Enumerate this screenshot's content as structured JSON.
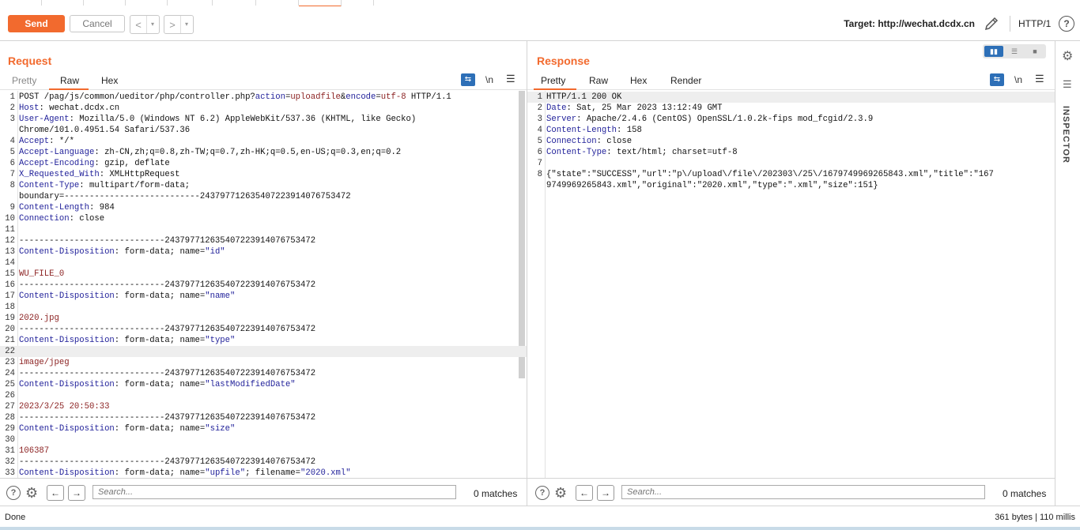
{
  "toolbar": {
    "send_label": "Send",
    "cancel_label": "Cancel",
    "back_glyph": "<",
    "forward_glyph": ">",
    "dropdown_glyph": "▾",
    "target_label": "Target: http://wechat.dcdx.cn",
    "protocol_label": "HTTP/1",
    "help_glyph": "?"
  },
  "request": {
    "title": "Request",
    "tabs": [
      "Pretty",
      "Raw",
      "Hex"
    ],
    "active_tab": "Raw",
    "newline_toggle": "\\n",
    "search_placeholder": "Search...",
    "matches": "0 matches",
    "lines": [
      {
        "n": "1",
        "t": "POST /pag/js/common/ueditor/php/controller.php?action=uploadfile&encode=utf-8 HTTP/1.1"
      },
      {
        "n": "2",
        "t": "Host: wechat.dcdx.cn"
      },
      {
        "n": "3",
        "t": "User-Agent: Mozilla/5.0 (Windows NT 6.2) AppleWebKit/537.36 (KHTML, like Gecko)"
      },
      {
        "n": "",
        "t": "Chrome/101.0.4951.54 Safari/537.36"
      },
      {
        "n": "4",
        "t": "Accept: */*"
      },
      {
        "n": "5",
        "t": "Accept-Language: zh-CN,zh;q=0.8,zh-TW;q=0.7,zh-HK;q=0.5,en-US;q=0.3,en;q=0.2"
      },
      {
        "n": "6",
        "t": "Accept-Encoding: gzip, deflate"
      },
      {
        "n": "7",
        "t": "X_Requested_With: XMLHttpRequest"
      },
      {
        "n": "8",
        "t": "Content-Type: multipart/form-data;"
      },
      {
        "n": "",
        "t": "boundary=---------------------------243797712635407223914076753472"
      },
      {
        "n": "9",
        "t": "Content-Length: 984"
      },
      {
        "n": "10",
        "t": "Connection: close"
      },
      {
        "n": "11",
        "t": ""
      },
      {
        "n": "12",
        "t": "-----------------------------243797712635407223914076753472"
      },
      {
        "n": "13",
        "t": "Content-Disposition: form-data; name=\"id\""
      },
      {
        "n": "14",
        "t": ""
      },
      {
        "n": "15",
        "t": "WU_FILE_0"
      },
      {
        "n": "16",
        "t": "-----------------------------243797712635407223914076753472"
      },
      {
        "n": "17",
        "t": "Content-Disposition: form-data; name=\"name\""
      },
      {
        "n": "18",
        "t": ""
      },
      {
        "n": "19",
        "t": "2020.jpg"
      },
      {
        "n": "20",
        "t": "-----------------------------243797712635407223914076753472"
      },
      {
        "n": "21",
        "t": "Content-Disposition: form-data; name=\"type\""
      },
      {
        "n": "22",
        "t": ""
      },
      {
        "n": "23",
        "t": "image/jpeg"
      },
      {
        "n": "24",
        "t": "-----------------------------243797712635407223914076753472"
      },
      {
        "n": "25",
        "t": "Content-Disposition: form-data; name=\"lastModifiedDate\""
      },
      {
        "n": "26",
        "t": ""
      },
      {
        "n": "27",
        "t": "2023/3/25 20:50:33"
      },
      {
        "n": "28",
        "t": "-----------------------------243797712635407223914076753472"
      },
      {
        "n": "29",
        "t": "Content-Disposition: form-data; name=\"size\""
      },
      {
        "n": "30",
        "t": ""
      },
      {
        "n": "31",
        "t": "106387"
      },
      {
        "n": "32",
        "t": "-----------------------------243797712635407223914076753472"
      },
      {
        "n": "33",
        "t": "Content-Disposition: form-data; name=\"upfile\"; filename=\"2020.xml\""
      }
    ]
  },
  "response": {
    "title": "Response",
    "tabs": [
      "Pretty",
      "Raw",
      "Hex",
      "Render"
    ],
    "active_tab": "Pretty",
    "newline_toggle": "\\n",
    "search_placeholder": "Search...",
    "matches": "0 matches",
    "lines": [
      {
        "n": "1",
        "t": "HTTP/1.1 200 OK"
      },
      {
        "n": "2",
        "t": "Date: Sat, 25 Mar 2023 13:12:49 GMT"
      },
      {
        "n": "3",
        "t": "Server: Apache/2.4.6 (CentOS) OpenSSL/1.0.2k-fips mod_fcgid/2.3.9"
      },
      {
        "n": "4",
        "t": "Content-Length: 158"
      },
      {
        "n": "5",
        "t": "Connection: close"
      },
      {
        "n": "6",
        "t": "Content-Type: text/html; charset=utf-8"
      },
      {
        "n": "7",
        "t": ""
      },
      {
        "n": "8",
        "t": "{\"state\":\"SUCCESS\",\"url\":\"p\\/upload\\/file\\/202303\\/25\\/1679749969265843.xml\",\"title\":\"167"
      },
      {
        "n": "",
        "t": "9749969265843.xml\",\"original\":\"2020.xml\",\"type\":\".xml\",\"size\":151}"
      }
    ]
  },
  "inspector": {
    "label": "INSPECTOR"
  },
  "status": {
    "left": "Done",
    "right": "361 bytes | 110 millis"
  },
  "colors": {
    "accent": "#f26a2e",
    "blue": "#2d6fb7"
  }
}
